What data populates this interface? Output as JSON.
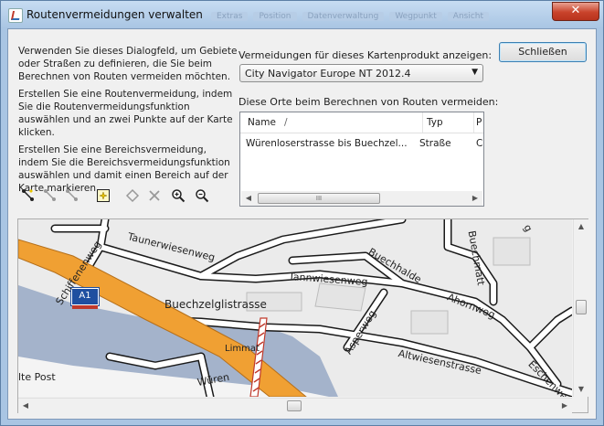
{
  "window": {
    "title": "Routenvermeidungen verwalten",
    "close_glyph": "✕",
    "background_tabs": [
      "Extras",
      "Position",
      "Datenverwaltung",
      "Wegpunkt",
      "Ansicht"
    ]
  },
  "intro": {
    "paragraph1": "Verwenden Sie dieses Dialogfeld, um Gebiete oder Straßen zu definieren, die Sie beim Berechnen von Routen vermeiden möchten.",
    "paragraph2": "Erstellen Sie eine Routenvermeidung, indem Sie die Routenvermeidungsfunktion auswählen und an zwei Punkte auf der Karte klicken.",
    "paragraph3": "Erstellen Sie eine Bereichsvermeidung, indem Sie die Bereichsvermeidungsfunktion auswählen und damit einen Bereich auf der Karte markieren."
  },
  "toolbar": {
    "icons": [
      "route-avoidance-tool-icon",
      "route-avoidance-disabled-icon",
      "route-avoidance-move-icon",
      "area-avoidance-tool-icon",
      "delete-point-icon",
      "delete-avoidance-icon",
      "zoom-in-icon",
      "zoom-out-icon"
    ]
  },
  "product": {
    "label": "Vermeidungen für dieses Kartenprodukt anzeigen:",
    "selected": "City Navigator Europe NT 2012.4"
  },
  "avoidances": {
    "label": "Diese Orte beim Berechnen von Routen vermeiden:",
    "columns": [
      "Name",
      "Typ",
      "P"
    ],
    "sort_indicator": "/",
    "rows": [
      {
        "name": "Würenloserstrasse bis Buechzel...",
        "type": "Straße",
        "extra": "C"
      }
    ],
    "scroll_left": "◀",
    "scroll_right": "▶",
    "thumb_grip": "III"
  },
  "buttons": {
    "close": "Schließen"
  },
  "map": {
    "labels": {
      "schiffenenweg": "Schiffenenweg",
      "taunerwiesenweg": "Taunerwiesenweg",
      "buechhalde": "Buechhalde",
      "buechmatt": "Buechmatt",
      "tannwiesenweg": "Tannwiesenweg",
      "ahornweg": "Ahornweg",
      "buechzelglistrasse": "Buechzelglistrasse",
      "asperweg": "Asperweg",
      "altwiesenstrasse": "Altwiesenstrasse",
      "eschenweg": "Eschenwe",
      "limmat": "Limmat",
      "alte_post": "lte Post",
      "wuren": "Würen",
      "top_partial": "g",
      "highway": "A1"
    },
    "colors": {
      "water": "#a4b3cb",
      "land": "#ebebeb",
      "motorway": "#f0a033",
      "road": "#ffffff",
      "road_casing": "#1a1a1a",
      "avoid_segment": "#c0392b"
    }
  }
}
